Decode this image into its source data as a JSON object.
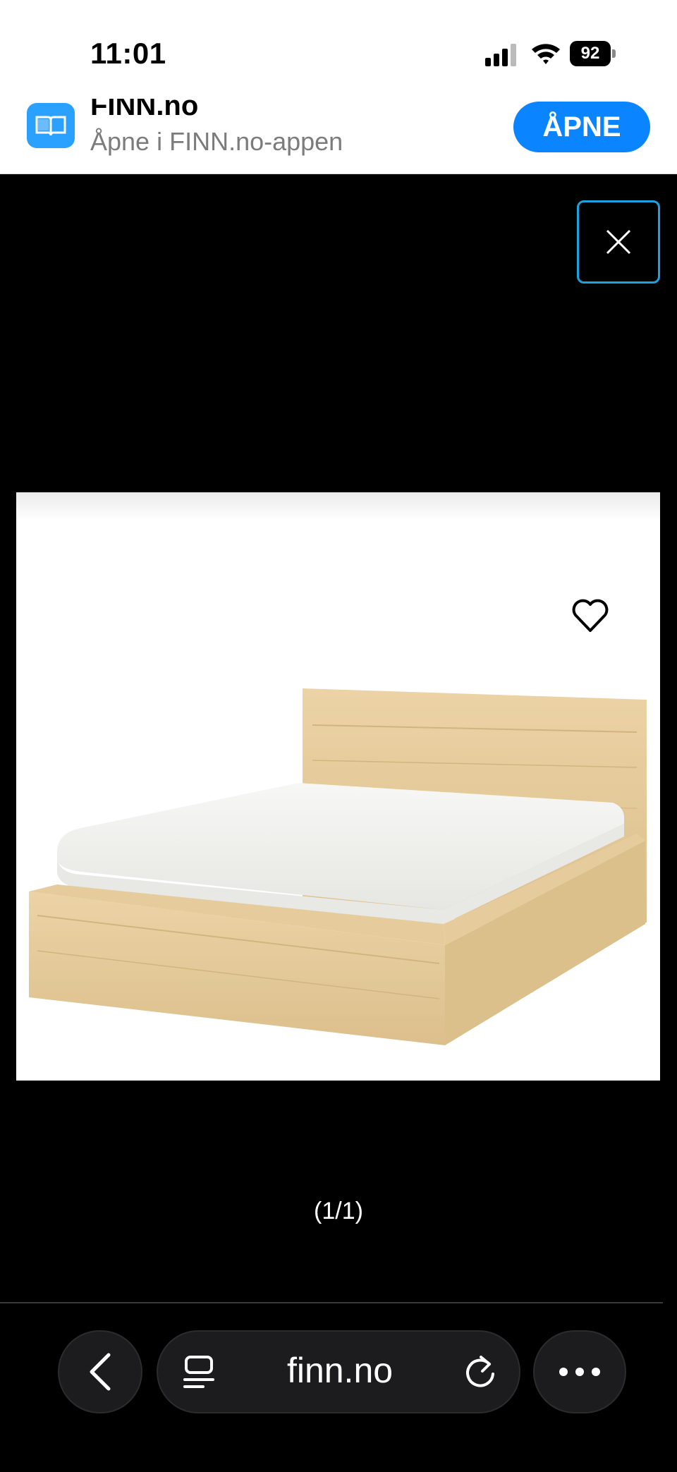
{
  "status_bar": {
    "time": "11:01",
    "battery": "92"
  },
  "app_banner": {
    "app_name": "FINN.no",
    "subtitle": "Åpne i FINN.no-appen",
    "open_button": "ÅPNE",
    "icon": "book-icon"
  },
  "viewer": {
    "close_icon": "close-icon",
    "favorite_icon": "heart-icon",
    "image_counter": "(1/1)"
  },
  "browser_bar": {
    "url": "finn.no",
    "back_icon": "chevron-left-icon",
    "reader_icon": "reader-icon",
    "reload_icon": "reload-icon",
    "more_icon": "more-icon"
  },
  "colors": {
    "accent": "#0a84ff",
    "close_border": "#1aa3e0",
    "wood": "#e3c99a"
  }
}
